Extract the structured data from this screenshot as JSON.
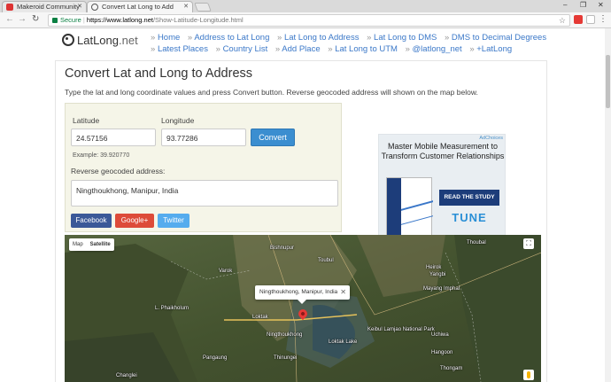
{
  "browser": {
    "tabs": [
      {
        "title": "Makeroid Community",
        "active": false
      },
      {
        "title": "Convert Lat Long to Add",
        "active": true
      }
    ],
    "window_controls": [
      "–",
      "❐",
      "✕"
    ],
    "secure_label": "Secure",
    "url_host": "https://www.latlong.net",
    "url_path": "/Show-Latitude-Longitude.html"
  },
  "site": {
    "logo_text": "LatLong",
    "logo_suffix": ".net",
    "nav": [
      "Home",
      "Address to Lat Long",
      "Lat Long to Address",
      "Lat Long to DMS",
      "DMS to Decimal Degrees",
      "Latest Places",
      "Country List",
      "Add Place",
      "Lat Long to UTM",
      "@latlong_net",
      "+LatLong"
    ]
  },
  "main": {
    "title": "Convert Lat and Long to Address",
    "intro": "Type the lat and long coordinate values and press Convert button. Reverse geocoded address will shown on the map below.",
    "latitude_label": "Latitude",
    "latitude_value": "24.57156",
    "longitude_label": "Longitude",
    "longitude_value": "93.77286",
    "convert_label": "Convert",
    "example": "Example: 39.920770",
    "address_label": "Reverse geocoded address:",
    "address_value": "Ningthoukhong, Manipur, India",
    "social": {
      "facebook": "Facebook",
      "google": "Google+",
      "twitter": "Twitter"
    }
  },
  "ad": {
    "choices": "AdChoices",
    "headline": "Master Mobile Measurement to Transform Customer Relationships",
    "button": "READ THE STUDY",
    "brand": "TUNE"
  },
  "map": {
    "type_map": "Map",
    "type_satellite": "Satellite",
    "infowindow": "Ningthoukhong, Manipur, India",
    "labels": [
      {
        "text": "Bishnupur",
        "name": "label-bishnupur"
      },
      {
        "text": "Toubul",
        "name": "label-toubul"
      },
      {
        "text": "Varok",
        "name": "label-varok"
      },
      {
        "text": "Thoubal",
        "name": "label-thoubal"
      },
      {
        "text": "Heirok",
        "name": "label-heirok"
      },
      {
        "text": "Yangbi",
        "name": "label-yangbi"
      },
      {
        "text": "Mayang Imphal",
        "name": "label-mayang"
      },
      {
        "text": "L. Phaikholum",
        "name": "label-phaikholum"
      },
      {
        "text": "Loktak",
        "name": "label-loktak"
      },
      {
        "text": "Ningthoukhong",
        "name": "label-ningthoukhong"
      },
      {
        "text": "Keibul Lamjao National Park",
        "name": "label-keibul"
      },
      {
        "text": "Uchiwa",
        "name": "label-uchiwa"
      },
      {
        "text": "Pangaung",
        "name": "label-pangaung"
      },
      {
        "text": "Thinungei",
        "name": "label-thinungei"
      },
      {
        "text": "Loktak Lake",
        "name": "label-loktak-lake"
      },
      {
        "text": "Hangoon",
        "name": "label-hangoon"
      },
      {
        "text": "Thongam",
        "name": "label-thongam"
      },
      {
        "text": "Changlei",
        "name": "label-changlei"
      }
    ]
  }
}
